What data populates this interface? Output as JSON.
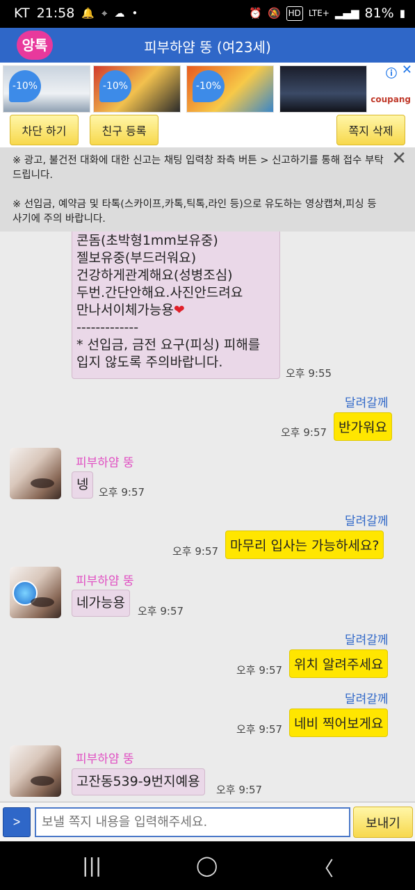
{
  "status_bar": {
    "carrier": "KT",
    "time": "21:58",
    "battery": "81%",
    "icons": [
      "notification-icon",
      "location-icon",
      "cloud-icon",
      "dot-icon",
      "alarm-icon",
      "mute-icon",
      "hd-icon",
      "lte-icon",
      "signal-icon",
      "battery-icon"
    ],
    "hd": "HD",
    "lte": "LTE+"
  },
  "header": {
    "logo_text": "앙톡",
    "title": "피부하얌 뚱 (여23세)",
    "color": "#2f67c8"
  },
  "ad": {
    "tags": [
      "-10%",
      "-10%",
      "-10%"
    ],
    "brand": "coupang"
  },
  "actions": {
    "block": "차단 하기",
    "add_friend": "친구 등록",
    "delete": "쪽지 삭제"
  },
  "notice": {
    "line1": "※ 광고, 불건전 대화에 대한 신고는 채팅 입력창 좌측 버튼 > 신고하기를 통해 접수 부탁 드립니다.",
    "line2": "※ 선입금, 예약금 및 타톡(스카이프,카톡,틱톡,라인 등)으로 유도하는 영상캡쳐,피싱 등 사기에 주의 바랍니다."
  },
  "messages": {
    "first_lines": [
      "콘돔(초박형1mm보유중)",
      "젤보유중(부드러워요)",
      "건강하게관계해요(성병조심)",
      "두번.간단안해요.사진안드려요",
      "만나서이체가능용",
      "-------------",
      "* 선입금, 금전 요구(피싱) 피해를",
      "입지 않도록 주의바랍니다."
    ],
    "first_time": "오후 9:55",
    "me_name": "달려갈께",
    "other_name": "피부하얌 뚱",
    "m1": "반가워요",
    "t1": "오후 9:57",
    "m2": "넹",
    "t2": "오후 9:57",
    "m3": "마무리 입사는 가능하세요?",
    "t3": "오후 9:57",
    "m4": "네가능용",
    "t4": "오후 9:57",
    "m5": "위치 알려주세요",
    "t5": "오후 9:57",
    "m6": "네비 찍어보게요",
    "t6": "오후 9:57",
    "m7": "고잔동539-9번지예용",
    "t7": "오후 9:57"
  },
  "input": {
    "toggle": ">",
    "placeholder": "보낼 쪽지 내용을 입력해주세요.",
    "send": "보내기"
  },
  "nav": {
    "recent": "|||",
    "home": "◯",
    "back": "〈"
  }
}
